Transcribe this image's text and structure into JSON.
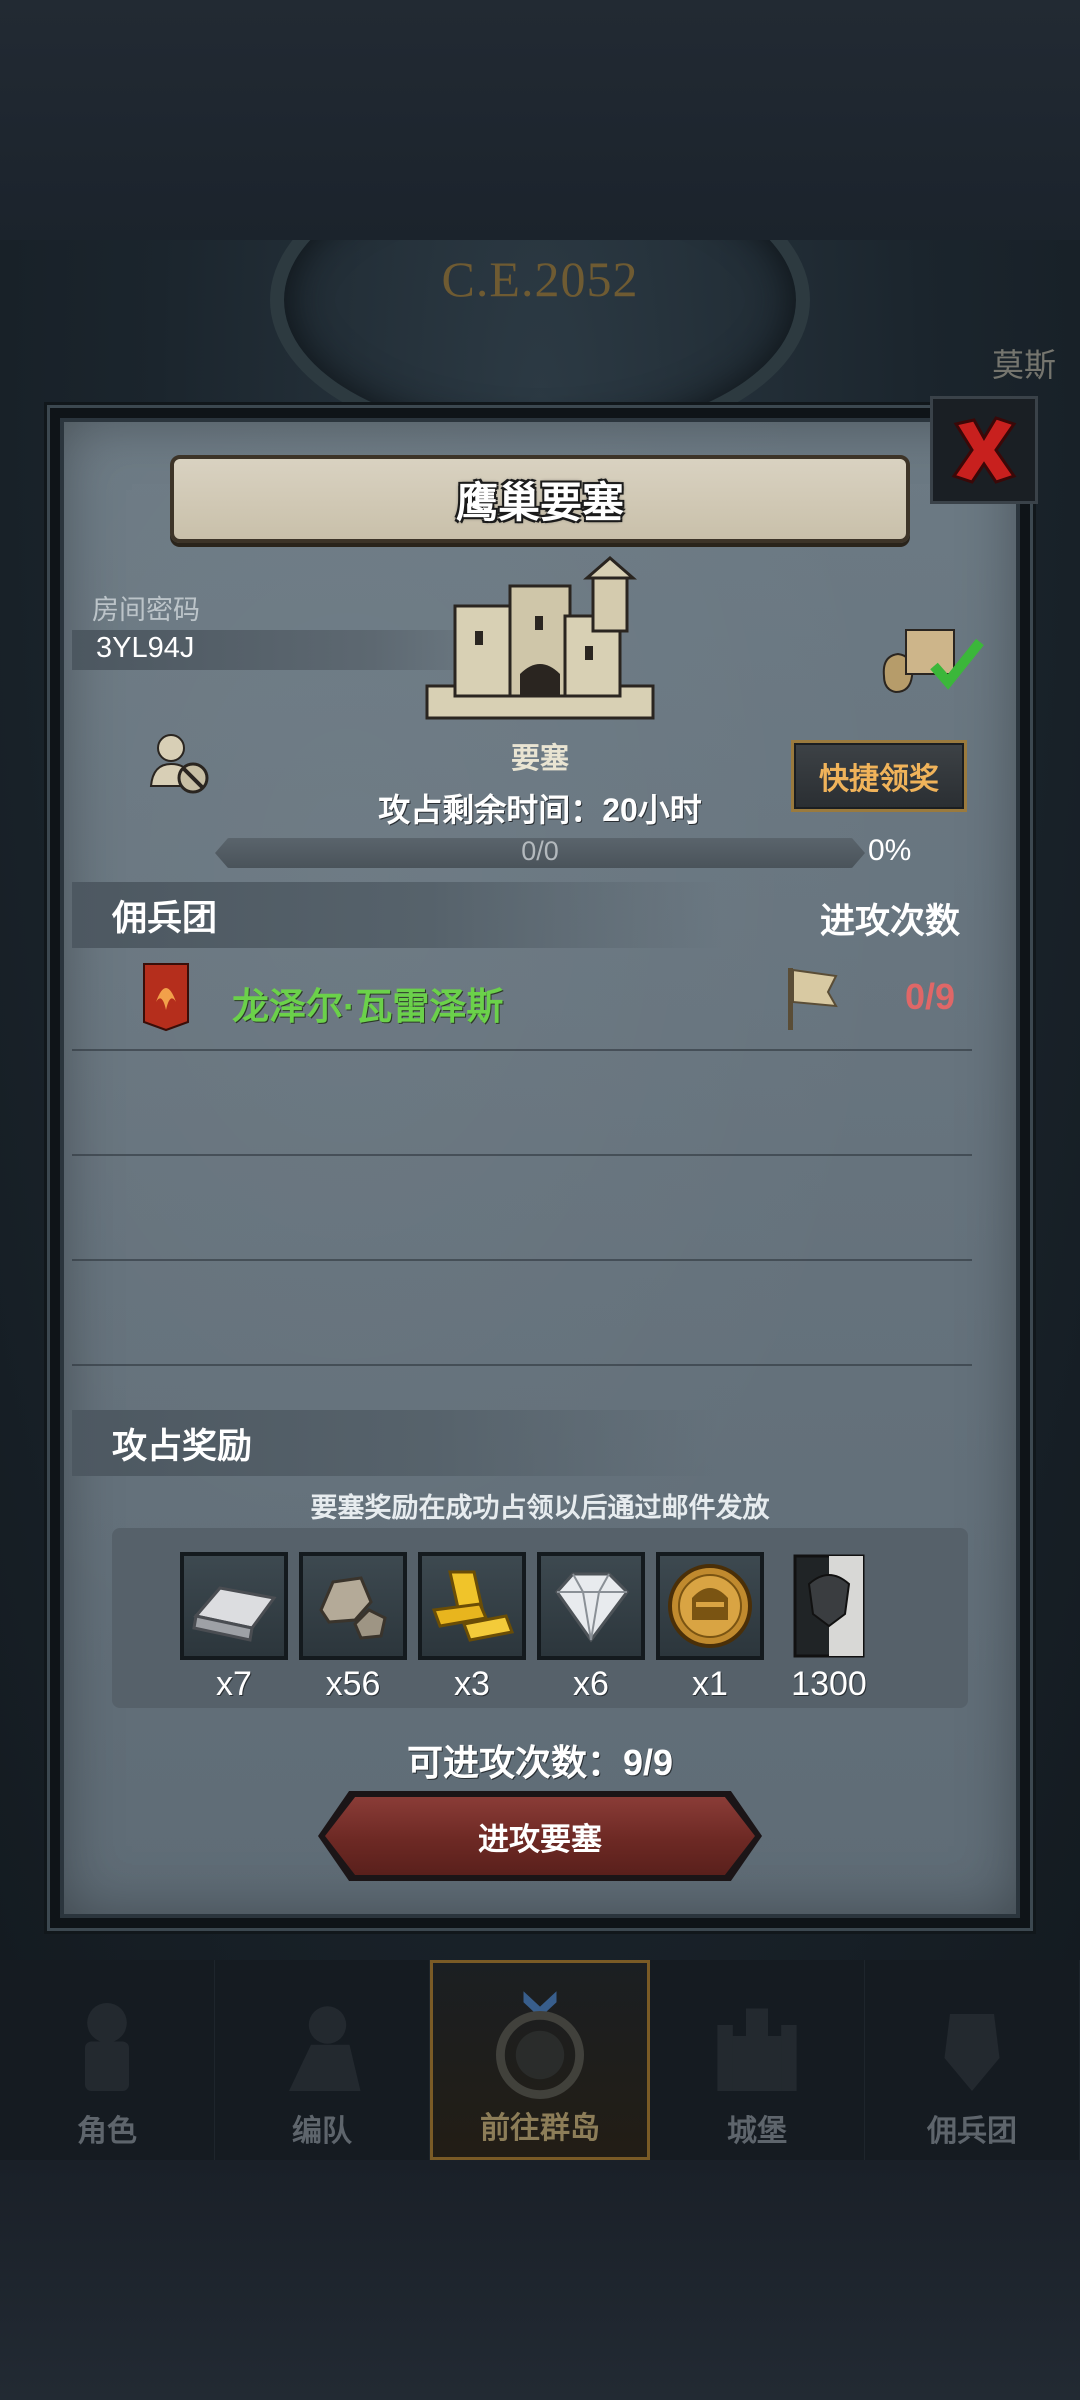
{
  "background": {
    "era": "C.E.2052",
    "place": "莫斯"
  },
  "dialog": {
    "title": "鹰巢要塞",
    "room_code_label": "房间密码",
    "room_code": "3YL94J",
    "fortress_type": "要塞",
    "remaining_time": "攻占剩余时间：20小时",
    "quick_claim": "快捷领奖",
    "progress": {
      "text": "0/0",
      "percent": "0%",
      "fraction": 0.0
    }
  },
  "mercenaries": {
    "header": "佣兵团",
    "attacks_header": "进攻次数",
    "rows": [
      {
        "name": "龙泽尔·瓦雷泽斯",
        "attacks": "0/9"
      }
    ]
  },
  "rewards": {
    "header": "攻占奖励",
    "note": "要塞奖励在成功占领以后通过邮件发放",
    "items": [
      {
        "icon": "silver-bar-icon",
        "count": "x7"
      },
      {
        "icon": "stone-icon",
        "count": "x56"
      },
      {
        "icon": "gold-bars-icon",
        "count": "x3"
      },
      {
        "icon": "diamond-icon",
        "count": "x6"
      },
      {
        "icon": "helmet-coin-icon",
        "count": "x1"
      },
      {
        "icon": "honor-banner-icon",
        "count": "1300"
      }
    ]
  },
  "available_attacks": "可进攻次数：9/9",
  "attack_button": "进攻要塞",
  "nav": {
    "items": [
      {
        "label": "角色",
        "icon": "knight-icon"
      },
      {
        "label": "编队",
        "icon": "soldier-icon"
      },
      {
        "label": "前往群岛",
        "icon": "island-icon"
      },
      {
        "label": "城堡",
        "icon": "castle-icon"
      },
      {
        "label": "佣兵团",
        "icon": "mercenary-icon"
      }
    ]
  },
  "colors": {
    "name_green": "#6bd14a",
    "attacks_red": "#e06767",
    "claim_orange": "#f0b35a",
    "attack_button": "#6d2924"
  }
}
